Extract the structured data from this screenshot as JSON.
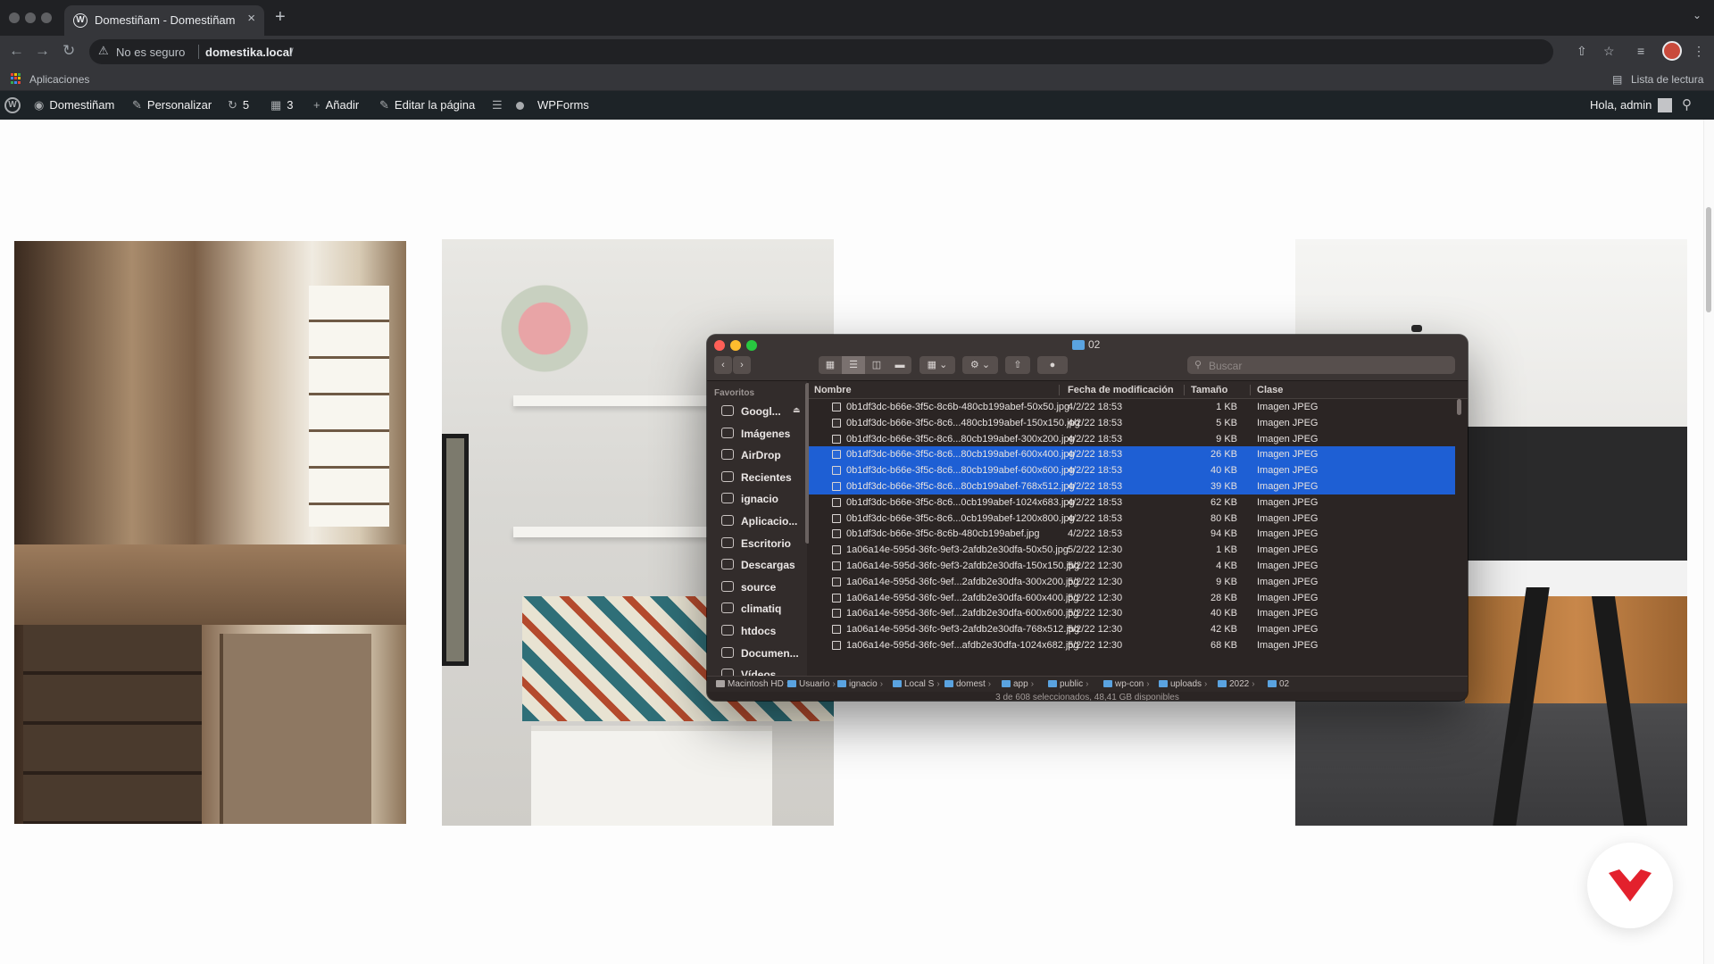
{
  "browser": {
    "tab_title": "Domestiñam - Domestiñam",
    "tab_close": "×",
    "new_tab": "+",
    "security_label": "No es seguro",
    "url_host": "domestika.local",
    "url_path": "/",
    "bookmarks": {
      "apps": "Aplicaciones",
      "reading_list": "Lista de lectura"
    },
    "colors": {
      "apps_grid": [
        "#ea4335",
        "#fbbc04",
        "#34a853",
        "#4285f4",
        "#ea4335",
        "#fbbc04",
        "#34a853",
        "#4285f4",
        "#ea4335"
      ]
    }
  },
  "wp_admin_bar": {
    "site_name": "Domestiñam",
    "customize": "Personalizar",
    "updates_count": "5",
    "comments_count": "3",
    "add_new": "Añadir",
    "edit_page": "Editar la página",
    "wpforms": "WPForms",
    "greeting": "Hola, admin"
  },
  "finder": {
    "title": "02",
    "search_placeholder": "Buscar",
    "sidebar_heading": "Favoritos",
    "sidebar_items": [
      {
        "label": "Googl...",
        "icon": "drive-icon"
      },
      {
        "label": "Imágenes",
        "icon": "camera-icon"
      },
      {
        "label": "AirDrop",
        "icon": "airdrop-icon"
      },
      {
        "label": "Recientes",
        "icon": "recent-icon"
      },
      {
        "label": "ignacio",
        "icon": "home-icon"
      },
      {
        "label": "Aplicacio...",
        "icon": "apps-icon"
      },
      {
        "label": "Escritorio",
        "icon": "desktop-icon"
      },
      {
        "label": "Descargas",
        "icon": "download-icon"
      },
      {
        "label": "source",
        "icon": "folder-icon"
      },
      {
        "label": "climatiq",
        "icon": "folder-icon"
      },
      {
        "label": "htdocs",
        "icon": "folder-icon"
      },
      {
        "label": "Documen...",
        "icon": "document-icon"
      },
      {
        "label": "Vídeos",
        "icon": "video-icon"
      }
    ],
    "columns": {
      "name": "Nombre",
      "modified": "Fecha de modificación",
      "size": "Tamaño",
      "kind": "Clase"
    },
    "files": [
      {
        "name": "0b1df3dc-b66e-3f5c-8c6b-480cb199abef-50x50.jpg",
        "date": "4/2/22 18:53",
        "size": "1 KB",
        "kind": "Imagen JPEG",
        "selected": false
      },
      {
        "name": "0b1df3dc-b66e-3f5c-8c6...480cb199abef-150x150.jpg",
        "date": "4/2/22 18:53",
        "size": "5 KB",
        "kind": "Imagen JPEG",
        "selected": false
      },
      {
        "name": "0b1df3dc-b66e-3f5c-8c6...80cb199abef-300x200.jpg",
        "date": "4/2/22 18:53",
        "size": "9 KB",
        "kind": "Imagen JPEG",
        "selected": false
      },
      {
        "name": "0b1df3dc-b66e-3f5c-8c6...80cb199abef-600x400.jpg",
        "date": "4/2/22 18:53",
        "size": "26 KB",
        "kind": "Imagen JPEG",
        "selected": true
      },
      {
        "name": "0b1df3dc-b66e-3f5c-8c6...80cb199abef-600x600.jpg",
        "date": "4/2/22 18:53",
        "size": "40 KB",
        "kind": "Imagen JPEG",
        "selected": true
      },
      {
        "name": "0b1df3dc-b66e-3f5c-8c6...80cb199abef-768x512.jpg",
        "date": "4/2/22 18:53",
        "size": "39 KB",
        "kind": "Imagen JPEG",
        "selected": true
      },
      {
        "name": "0b1df3dc-b66e-3f5c-8c6...0cb199abef-1024x683.jpg",
        "date": "4/2/22 18:53",
        "size": "62 KB",
        "kind": "Imagen JPEG",
        "selected": false
      },
      {
        "name": "0b1df3dc-b66e-3f5c-8c6...0cb199abef-1200x800.jpg",
        "date": "4/2/22 18:53",
        "size": "80 KB",
        "kind": "Imagen JPEG",
        "selected": false
      },
      {
        "name": "0b1df3dc-b66e-3f5c-8c6b-480cb199abef.jpg",
        "date": "4/2/22 18:53",
        "size": "94 KB",
        "kind": "Imagen JPEG",
        "selected": false
      },
      {
        "name": "1a06a14e-595d-36fc-9ef3-2afdb2e30dfa-50x50.jpg",
        "date": "5/2/22 12:30",
        "size": "1 KB",
        "kind": "Imagen JPEG",
        "selected": false
      },
      {
        "name": "1a06a14e-595d-36fc-9ef3-2afdb2e30dfa-150x150.jpg",
        "date": "5/2/22 12:30",
        "size": "4 KB",
        "kind": "Imagen JPEG",
        "selected": false
      },
      {
        "name": "1a06a14e-595d-36fc-9ef...2afdb2e30dfa-300x200.jpg",
        "date": "5/2/22 12:30",
        "size": "9 KB",
        "kind": "Imagen JPEG",
        "selected": false
      },
      {
        "name": "1a06a14e-595d-36fc-9ef...2afdb2e30dfa-600x400.jpg",
        "date": "5/2/22 12:30",
        "size": "28 KB",
        "kind": "Imagen JPEG",
        "selected": false
      },
      {
        "name": "1a06a14e-595d-36fc-9ef...2afdb2e30dfa-600x600.jpg",
        "date": "5/2/22 12:30",
        "size": "40 KB",
        "kind": "Imagen JPEG",
        "selected": false
      },
      {
        "name": "1a06a14e-595d-36fc-9ef3-2afdb2e30dfa-768x512.jpg",
        "date": "5/2/22 12:30",
        "size": "42 KB",
        "kind": "Imagen JPEG",
        "selected": false
      },
      {
        "name": "1a06a14e-595d-36fc-9ef...afdb2e30dfa-1024x682.jpg",
        "date": "5/2/22 12:30",
        "size": "68 KB",
        "kind": "Imagen JPEG",
        "selected": false
      }
    ],
    "path": [
      "Macintosh HD",
      "Usuario",
      "ignacio",
      "Local S",
      "domest",
      "app",
      "public",
      "wp-con",
      "uploads",
      "2022",
      "02"
    ],
    "status": "3 de 608 seleccionados, 48,41 GB disponibles",
    "colors": {
      "selection": "#1e5fd4",
      "folder": "#5aa3e0"
    }
  },
  "brand_colors": {
    "domestika_red": "#e3212d"
  }
}
